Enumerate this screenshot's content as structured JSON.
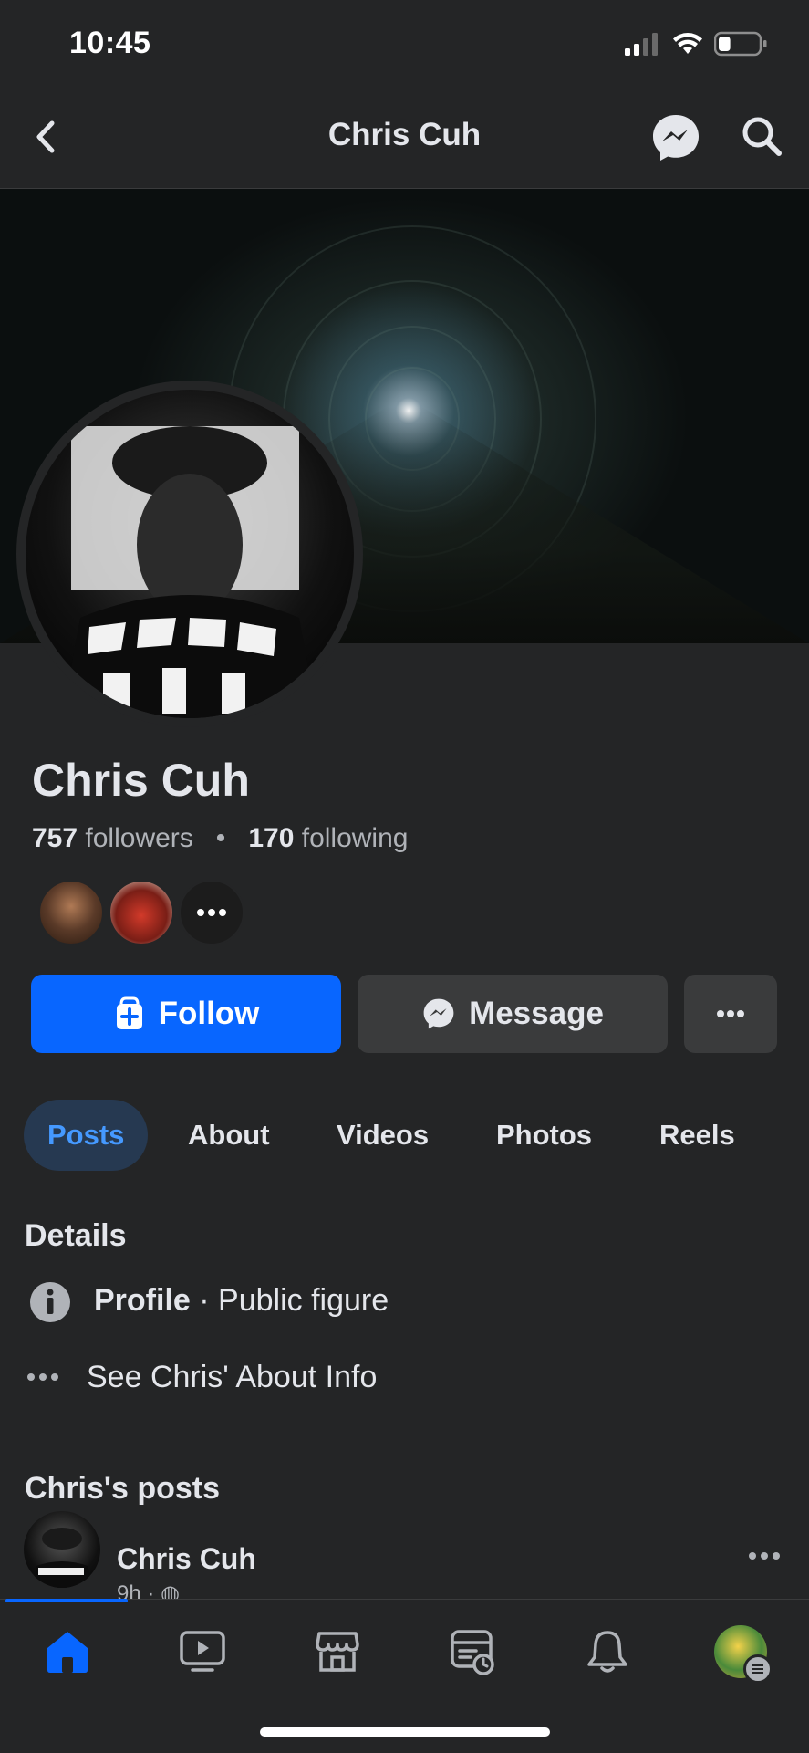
{
  "status_bar": {
    "time": "10:45",
    "battery_level": 0.3
  },
  "top_bar": {
    "title": "Chris Cuh"
  },
  "profile": {
    "name": "Chris Cuh",
    "followers_count": "757",
    "followers_label": "followers",
    "separator": "•",
    "following_count": "170",
    "following_label": "following"
  },
  "actions": {
    "follow_label": "Follow",
    "message_label": "Message"
  },
  "tabs": [
    {
      "label": "Posts",
      "active": true
    },
    {
      "label": "About",
      "active": false
    },
    {
      "label": "Videos",
      "active": false
    },
    {
      "label": "Photos",
      "active": false
    },
    {
      "label": "Reels",
      "active": false
    }
  ],
  "details": {
    "heading": "Details",
    "profile_label": "Profile",
    "profile_value": "· Public figure",
    "see_about": "See Chris' About Info"
  },
  "posts": {
    "heading": "Chris's posts",
    "author": "Chris Cuh",
    "time": "9h · "
  },
  "colors": {
    "accent": "#0866ff",
    "background": "#242526",
    "button_dark": "#3a3b3c",
    "active_tab_bg": "#263951"
  },
  "icons": {
    "back": "chevron-left-icon",
    "messenger": "messenger-icon",
    "search": "search-icon",
    "home": "home-icon",
    "video": "video-icon",
    "marketplace": "marketplace-icon",
    "feeds": "feeds-icon",
    "notifications": "bell-icon",
    "menu": "profile-menu-icon"
  }
}
